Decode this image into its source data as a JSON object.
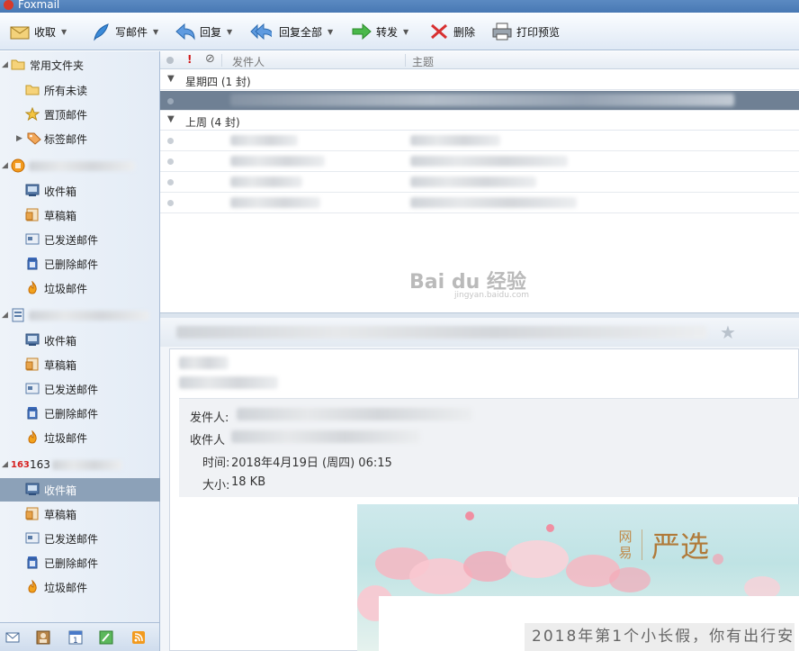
{
  "app": {
    "title": "Foxmail"
  },
  "toolbar": {
    "receive": "收取",
    "compose": "写邮件",
    "reply": "回复",
    "reply_all": "回复全部",
    "forward": "转发",
    "delete": "删除",
    "print_preview": "打印预览"
  },
  "sidebar": {
    "favorites": {
      "label": "常用文件夹",
      "items": [
        "所有未读",
        "置顶邮件",
        "标签邮件"
      ]
    },
    "account1": {
      "items": [
        "收件箱",
        "草稿箱",
        "已发送邮件",
        "已删除邮件",
        "垃圾邮件"
      ]
    },
    "account2": {
      "items": [
        "收件箱",
        "草稿箱",
        "已发送邮件",
        "已删除邮件",
        "垃圾邮件"
      ]
    },
    "account3": {
      "badge": "163",
      "label": "163",
      "items": [
        "收件箱",
        "草稿箱",
        "已发送邮件",
        "已删除邮件",
        "垃圾邮件"
      ],
      "selected": "收件箱"
    }
  },
  "maillist": {
    "columns": {
      "flag": "!",
      "sender": "发件人",
      "subject": "主题"
    },
    "groups": [
      {
        "label": "星期四 (1 封)"
      },
      {
        "label": "上周 (4 封)"
      }
    ]
  },
  "preview": {
    "sender_label": "发件人:",
    "recipient_label": "收件人",
    "time_label": "时间:",
    "time_value": "2018年4月19日 (周四) 06:15",
    "size_label": "大小:",
    "size_value": "18 KB",
    "banner": {
      "logo_vertical": [
        "网",
        "易"
      ],
      "logo_main": "严选",
      "headline": "2018年第1个小长假，你有出行安"
    }
  },
  "watermark": {
    "main": "Bai du 经验",
    "sub": "jingyan.baidu.com"
  },
  "colors": {
    "titlebar": "#4878b4",
    "selected_row": "#8ca1b8",
    "selected_mail": "#6f8094"
  }
}
